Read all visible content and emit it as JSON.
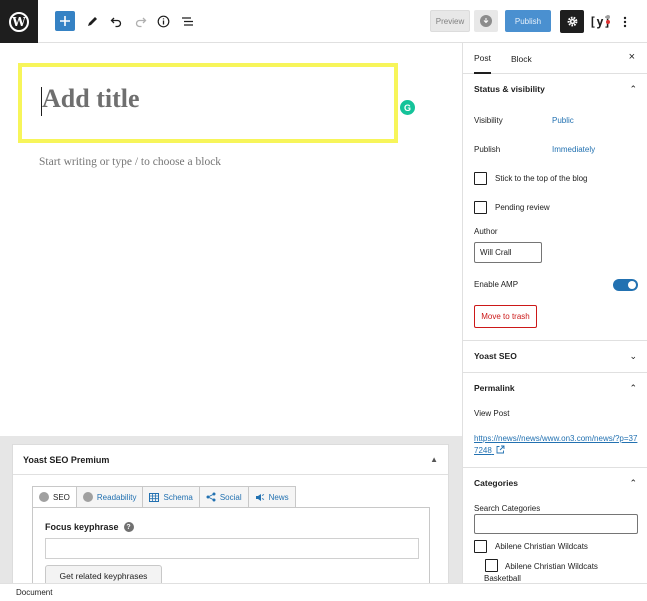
{
  "toolbar": {
    "logo_letter": "W",
    "add_icon": "plus-icon",
    "tools_icon": "pencil-icon",
    "undo_icon": "undo-icon",
    "redo_icon": "redo-icon",
    "info_icon": "info-icon",
    "list_view_icon": "list-view-icon",
    "preview_label": "Preview",
    "save_icon": "save-draft-icon",
    "publish_label": "Publish",
    "settings_icon": "gear-icon",
    "yoast_label": "[y]",
    "more_icon": "more-vertical-icon"
  },
  "editor": {
    "title_placeholder": "Add title",
    "block_placeholder": "Start writing or type / to choose a block",
    "grammarly_letter": "G",
    "highlight_color": "#f7f55a"
  },
  "yoast_metabox": {
    "title": "Yoast SEO Premium",
    "tabs": [
      {
        "label": "SEO"
      },
      {
        "label": "Readability"
      },
      {
        "label": "Schema"
      },
      {
        "label": "Social"
      },
      {
        "label": "News"
      }
    ],
    "focus_label": "Focus keyphrase",
    "help_symbol": "?",
    "focus_value": "",
    "related_button": "Get related keyphrases"
  },
  "footer": {
    "breadcrumb": "Document"
  },
  "sidebar": {
    "tabs": [
      "Post",
      "Block"
    ],
    "close_symbol": "×",
    "status": {
      "heading": "Status & visibility",
      "visibility_label": "Visibility",
      "visibility_value": "Public",
      "publish_label": "Publish",
      "publish_value": "Immediately",
      "sticky_label": "Stick to the top of the blog",
      "pending_label": "Pending review",
      "author_label": "Author",
      "author_value": "Will Crall",
      "amp_label": "Enable AMP",
      "amp_enabled": true,
      "trash_label": "Move to trash"
    },
    "yoast": {
      "heading": "Yoast SEO"
    },
    "permalink": {
      "heading": "Permalink",
      "view_label": "View Post",
      "url": "https://news//news/www.on3.com/news/?p=377248"
    },
    "categories": {
      "heading": "Categories",
      "search_label": "Search Categories",
      "items": [
        {
          "label": "Abilene Christian Wildcats"
        },
        {
          "label": "Abilene Christian Wildcats Basketball"
        }
      ]
    }
  },
  "colors": {
    "accent": "#2271b1",
    "danger": "#cc1818",
    "dark": "#1e1e1e"
  }
}
